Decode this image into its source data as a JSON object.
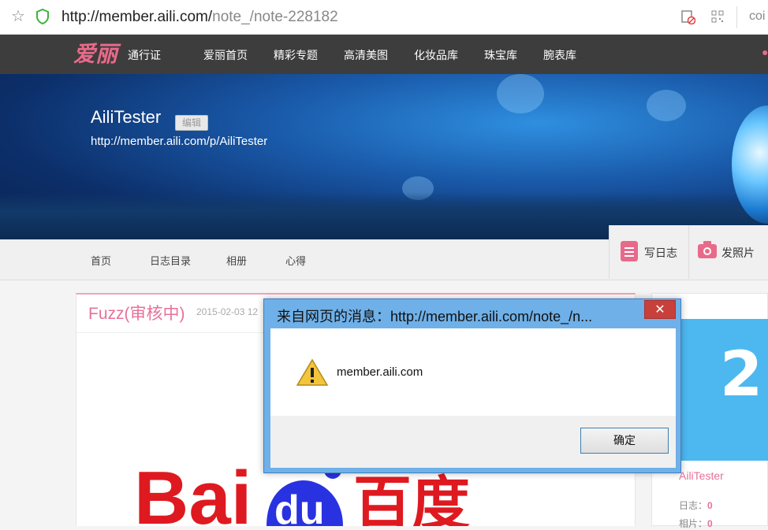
{
  "browser": {
    "url_host": "http://member.aili.com/",
    "url_path": "note_/note-228182",
    "ext_text": "coi"
  },
  "nav": {
    "logo": "爱丽",
    "pass": "通行证",
    "items": [
      "爱丽首页",
      "精彩专题",
      "高清美图",
      "化妆品库",
      "珠宝库",
      "腕表库"
    ]
  },
  "banner": {
    "username": "AiliTester",
    "edit_label": "编辑",
    "profile_url": "http://member.aili.com/p/AiliTester"
  },
  "subnav": {
    "items": [
      "首页",
      "日志目录",
      "相册",
      "心得"
    ],
    "write_label": "写日志",
    "photo_label": "发照片"
  },
  "post": {
    "title": "Fuzz(审核中)",
    "date": "2015-02-03 12"
  },
  "sidebar": {
    "number": "2",
    "name": "AiliTester",
    "logs_label": "日志：",
    "logs_count": "0",
    "photos_label": "相片：",
    "photos_count": "0"
  },
  "dialog": {
    "title": "来自网页的消息：http://member.aili.com/note_/n...",
    "message": "member.aili.com",
    "ok_label": "确定",
    "close_label": "✕"
  },
  "image_logo_text": "Bai du 百度",
  "colors": {
    "accent": "#e8709a",
    "dialog_frame": "#6fb0e8",
    "close_red": "#c7403a"
  }
}
